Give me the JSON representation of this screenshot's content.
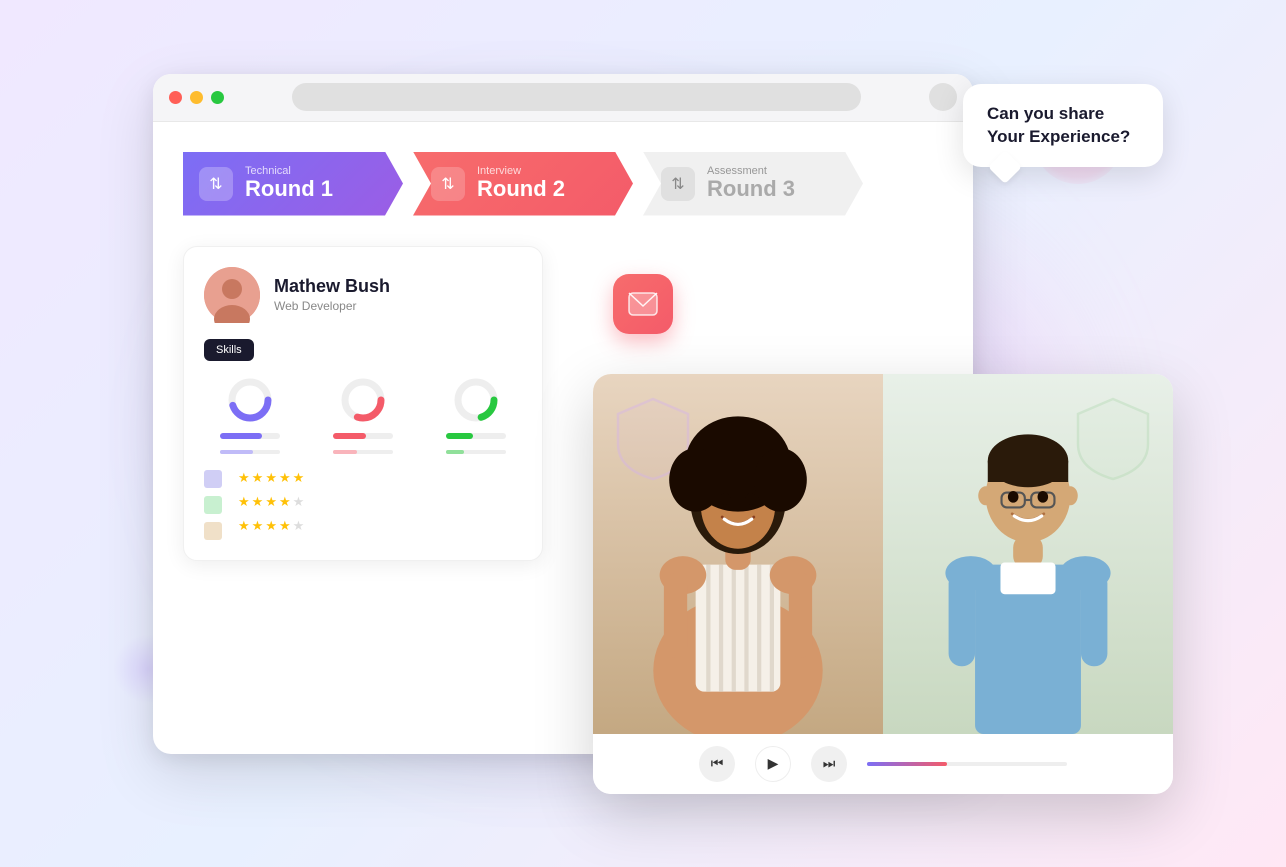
{
  "scene": {
    "background": "#f0e8ff"
  },
  "browser": {
    "dots": [
      "red",
      "yellow",
      "green"
    ]
  },
  "steps": [
    {
      "id": "step-1",
      "label": "Technical",
      "title": "Round 1",
      "style": "purple",
      "icon": "⇅"
    },
    {
      "id": "step-2",
      "label": "Interview",
      "title": "Round 2",
      "style": "coral",
      "icon": "⇅"
    },
    {
      "id": "step-3",
      "label": "Assessment",
      "title": "Round 3",
      "style": "gray",
      "icon": "⇅"
    }
  ],
  "profile": {
    "name": "Mathew Bush",
    "role": "Web Developer",
    "skills_label": "Skills",
    "skills": [
      {
        "color": "#7c6ef5",
        "percent": 70
      },
      {
        "color": "#f45b69",
        "percent": 55
      },
      {
        "color": "#28c840",
        "percent": 45
      }
    ],
    "ratings": [
      {
        "stars": 4.5,
        "filled": 4,
        "half": 1,
        "empty": 0
      },
      {
        "stars": 4.0,
        "filled": 4,
        "half": 0,
        "empty": 1
      },
      {
        "stars": 3.5,
        "filled": 3,
        "half": 1,
        "empty": 1
      }
    ]
  },
  "video": {
    "controls": {
      "rewind": "⏮",
      "play": "▶",
      "forward": "⏭"
    },
    "progress_percent": 40
  },
  "speech_bubble": {
    "line1": "Can you share",
    "line2": "Your Experience?"
  }
}
